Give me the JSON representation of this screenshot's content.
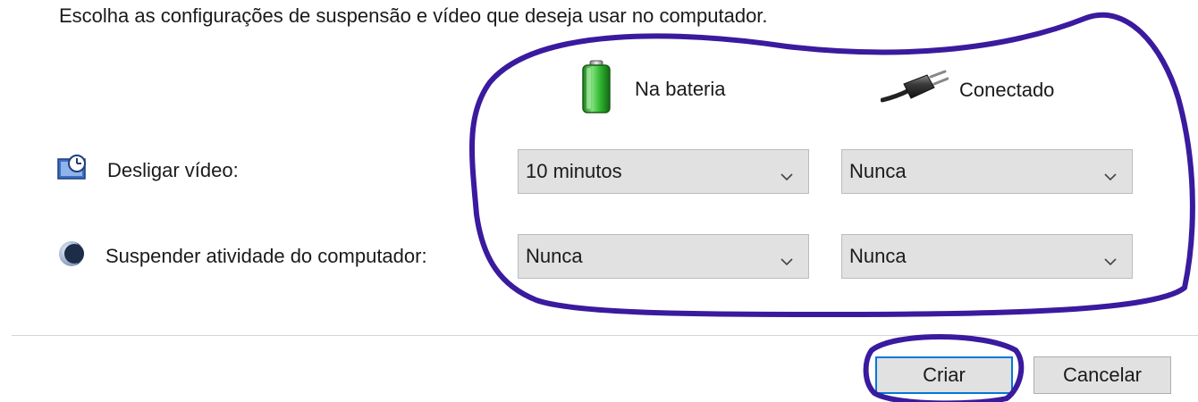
{
  "intro_text": "Escolha as configurações de suspensão e vídeo que deseja usar no computador.",
  "columns": {
    "battery": {
      "label": "Na bateria",
      "icon": "battery-icon"
    },
    "plugged": {
      "label": "Conectado",
      "icon": "power-plug-icon"
    }
  },
  "settings": {
    "display_off": {
      "label": "Desligar vídeo:",
      "icon": "display-clock-icon",
      "battery_value": "10 minutos",
      "plugged_value": "Nunca"
    },
    "sleep": {
      "label": "Suspender atividade do computador:",
      "icon": "moon-sleep-icon",
      "battery_value": "Nunca",
      "plugged_value": "Nunca"
    }
  },
  "buttons": {
    "create": "Criar",
    "cancel": "Cancelar"
  },
  "colors": {
    "annotation": "#3a1a9e",
    "focus_border": "#0078d7",
    "control_bg": "#e1e1e1"
  }
}
